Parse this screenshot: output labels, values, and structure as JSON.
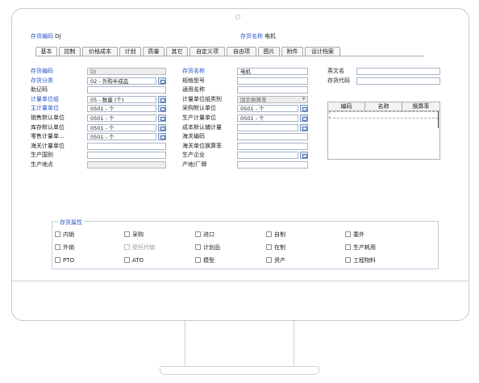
{
  "header": {
    "code_label": "存货编码",
    "code_value": "DJ",
    "name_label": "存货名称",
    "name_value": "电机"
  },
  "tabs": [
    {
      "label": "基本",
      "active": true
    },
    {
      "label": "控制"
    },
    {
      "label": "价格成本"
    },
    {
      "label": "计划"
    },
    {
      "label": "质量"
    },
    {
      "label": "其它"
    },
    {
      "label": "自定义项"
    },
    {
      "label": "自由项"
    },
    {
      "label": "图片"
    },
    {
      "label": "附件"
    },
    {
      "label": "设计档案"
    }
  ],
  "col1": [
    {
      "label": "存货编码",
      "value": "DJ",
      "blue": true,
      "gray": true
    },
    {
      "label": "存货分类",
      "value": "02 - 外购半成品",
      "blue": true,
      "btn": true
    },
    {
      "label": "助记码",
      "value": ""
    },
    {
      "label": "计量单位组",
      "value": "05 - 数量 (个)",
      "blue": true,
      "btn": true
    },
    {
      "label": "主计量单位",
      "value": "0501 - 个",
      "blue": true,
      "btn": true
    },
    {
      "label": "销售默认单位",
      "value": "0501 - 个",
      "btn": true
    },
    {
      "label": "库存默认单位",
      "value": "0501 - 个",
      "btn": true
    },
    {
      "label": "零售计量单...",
      "value": "0501 - 个",
      "btn": true
    },
    {
      "label": "海关计量单位",
      "value": ""
    },
    {
      "label": "生产国别",
      "value": ""
    },
    {
      "label": "生产地点",
      "value": "",
      "gray": true
    }
  ],
  "col2": [
    {
      "label": "存货名称",
      "value": "电机",
      "blue": true
    },
    {
      "label": "规格型号",
      "value": ""
    },
    {
      "label": "通用名称",
      "value": ""
    },
    {
      "label": "计量单位组类别",
      "value": "固定换算率",
      "gray": true,
      "dropdown": true
    },
    {
      "label": "采购默认单位",
      "value": "0501 - 个",
      "btn": true
    },
    {
      "label": "生产计量单位",
      "value": "0501 - 个",
      "btn": true
    },
    {
      "label": "成本默认辅计量",
      "value": "",
      "btn": true
    },
    {
      "label": "海关编码",
      "value": ""
    },
    {
      "label": "海关单位换算率",
      "value": ""
    },
    {
      "label": "生产企业",
      "value": "",
      "btn": true
    },
    {
      "label": "产地/厂牌",
      "value": ""
    }
  ],
  "col3": [
    {
      "label": "英文名",
      "value": ""
    },
    {
      "label": "存货代码",
      "value": ""
    }
  ],
  "unit_grid": {
    "columns": [
      "编码",
      "名称",
      "换算率"
    ]
  },
  "attributes": {
    "title": "存货属性",
    "rows": [
      [
        {
          "label": "内销"
        },
        {
          "label": "采购"
        },
        {
          "label": "进口"
        },
        {
          "label": "自制"
        },
        {
          "label": "委外"
        }
      ],
      [
        {
          "label": "外销"
        },
        {
          "label": "受托代销",
          "disabled": true
        },
        {
          "label": "计划品"
        },
        {
          "label": "在制"
        },
        {
          "label": "生产耗用"
        }
      ],
      [
        {
          "label": "PTO"
        },
        {
          "label": "ATO"
        },
        {
          "label": "模型"
        },
        {
          "label": "资产"
        },
        {
          "label": "工程物料"
        }
      ]
    ]
  }
}
